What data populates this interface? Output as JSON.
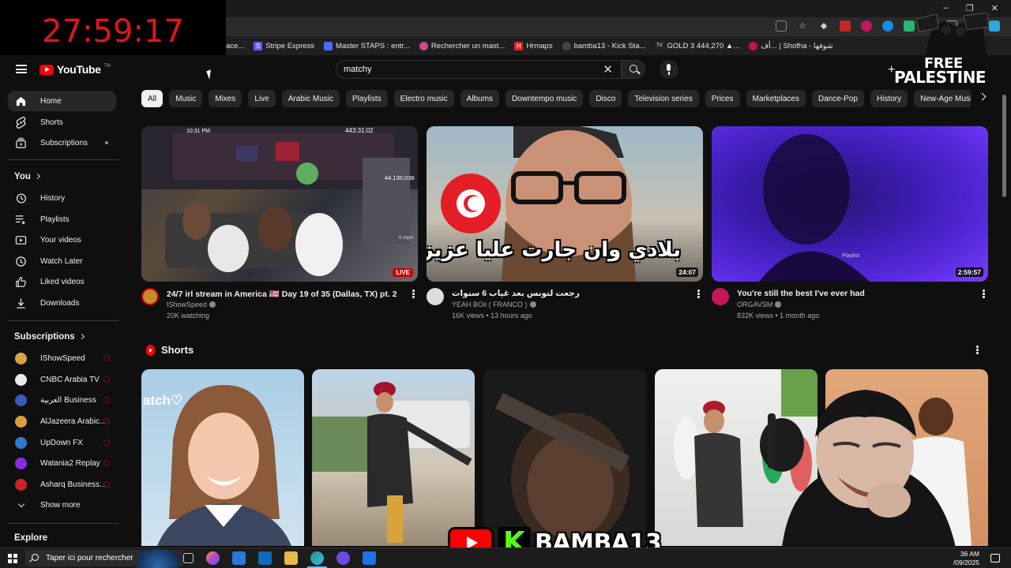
{
  "timer": {
    "value": "27:59:17"
  },
  "browser": {
    "window_controls": [
      "–",
      "❐",
      "✕"
    ],
    "bookmarks": [
      {
        "label": "ace...",
        "icon_color": "#555555",
        "glyph": ""
      },
      {
        "label": "Stripe Express",
        "icon_color": "#635bff",
        "glyph": "S"
      },
      {
        "label": "Master STAPS : entr...",
        "icon_color": "#4b6cff",
        "glyph": ""
      },
      {
        "label": "Rechercher un mast...",
        "icon_color": "#c84b8a",
        "glyph": ""
      },
      {
        "label": "Hrmaps",
        "icon_color": "#d62828",
        "glyph": "H"
      },
      {
        "label": "bamba13 - Kick Sta...",
        "icon_color": "#444444",
        "glyph": ""
      },
      {
        "label": "GOLD 3 444,270 ▲...",
        "icon_color": "#222222",
        "glyph": "TV"
      },
      {
        "label": "أف... | Shofha - شوفها",
        "icon_color": "#c0115a",
        "glyph": ""
      }
    ]
  },
  "header": {
    "logo_text": "YouTube",
    "logo_sup": "TN",
    "search": {
      "value": "matchy"
    }
  },
  "overlay_palestine": {
    "line1": "FREE",
    "line2": "PALESTINE"
  },
  "sidebar": {
    "main": [
      {
        "label": "Home",
        "icon": "home-icon",
        "active": true
      },
      {
        "label": "Shorts",
        "icon": "shorts-icon"
      },
      {
        "label": "Subscriptions",
        "icon": "subscriptions-icon",
        "dot": true
      }
    ],
    "you_heading": "You",
    "you": [
      {
        "label": "History",
        "icon": "history-icon"
      },
      {
        "label": "Playlists",
        "icon": "playlists-icon"
      },
      {
        "label": "Your videos",
        "icon": "your-videos-icon"
      },
      {
        "label": "Watch Later",
        "icon": "watch-later-icon"
      },
      {
        "label": "Liked videos",
        "icon": "liked-videos-icon"
      },
      {
        "label": "Downloads",
        "icon": "downloads-icon"
      }
    ],
    "subscriptions_heading": "Subscriptions",
    "subscriptions": [
      {
        "label": "IShowSpeed",
        "color": "#d9a441"
      },
      {
        "label": "CNBC Arabia TV",
        "color": "#eaeaea"
      },
      {
        "label": "العربية Business",
        "color": "#3c5bb8"
      },
      {
        "label": "AlJazeera Arabic...",
        "color": "#d7a13a"
      },
      {
        "label": "UpDown FX",
        "color": "#2e7bd6"
      },
      {
        "label": "Watania2 Replay",
        "color": "#8a2be2"
      },
      {
        "label": "Asharq Business...",
        "color": "#d11f2a"
      }
    ],
    "show_more": "Show more",
    "explore_heading": "Explore"
  },
  "chips": [
    "All",
    "Music",
    "Mixes",
    "Live",
    "Arabic Music",
    "Playlists",
    "Electro music",
    "Albums",
    "Downtempo music",
    "Disco",
    "Television series",
    "Prices",
    "Marketplaces",
    "Dance-Pop",
    "History",
    "New-Age Music"
  ],
  "videos": [
    {
      "title": "24/7 irl stream in America 🇺🇸 Day 19 of 35 (Dallas, TX) pt. 2",
      "channel": "IShowSpeed",
      "stats": "20K watching",
      "badge": "LIVE",
      "thumb_overlay": [
        "10:31 PM",
        "443:31:02",
        "44,130,038",
        "0 mph"
      ],
      "avatar_color": "#c9892f"
    },
    {
      "title": "رجعت لتونس بعد غياب 6 سنوات",
      "channel": "YEAH BOii ( FRANCO )",
      "stats": "16K views • 13 hours ago",
      "duration": "24:07",
      "thumb_caption": "بلادي وان جارت عليا عزيزة",
      "avatar_color": "#dddddd"
    },
    {
      "title": "You're still the best I've ever had",
      "channel": "ORGAVSM",
      "stats": "832K views • 1 month ago",
      "duration": "2:59:57",
      "thumb_caption": "Playlist",
      "avatar_color": "#c2185b"
    }
  ],
  "shorts": {
    "title": "Shorts",
    "items": [
      {
        "overlay": "atch♡"
      },
      {
        "overlay": ""
      },
      {
        "overlay": ""
      },
      {
        "overlay": ""
      },
      {
        "overlay": ""
      }
    ]
  },
  "overlay_bamba": {
    "k": "K",
    "name": "BAMBA13"
  },
  "taskbar": {
    "search_placeholder": "Taper ici pour rechercher",
    "time": "36 AM",
    "date": "/09/2025",
    "apps": [
      "#3b3b3b",
      "#f1a60d",
      "#2b78d6",
      "#0f6cbd",
      "#e8b84b",
      "#1f8f87",
      "#6d4ae8",
      "#1a73e8"
    ]
  },
  "colors": {
    "accent_red": "#ff0000",
    "timer_red": "#e3141b",
    "kick_green": "#53fc18"
  }
}
